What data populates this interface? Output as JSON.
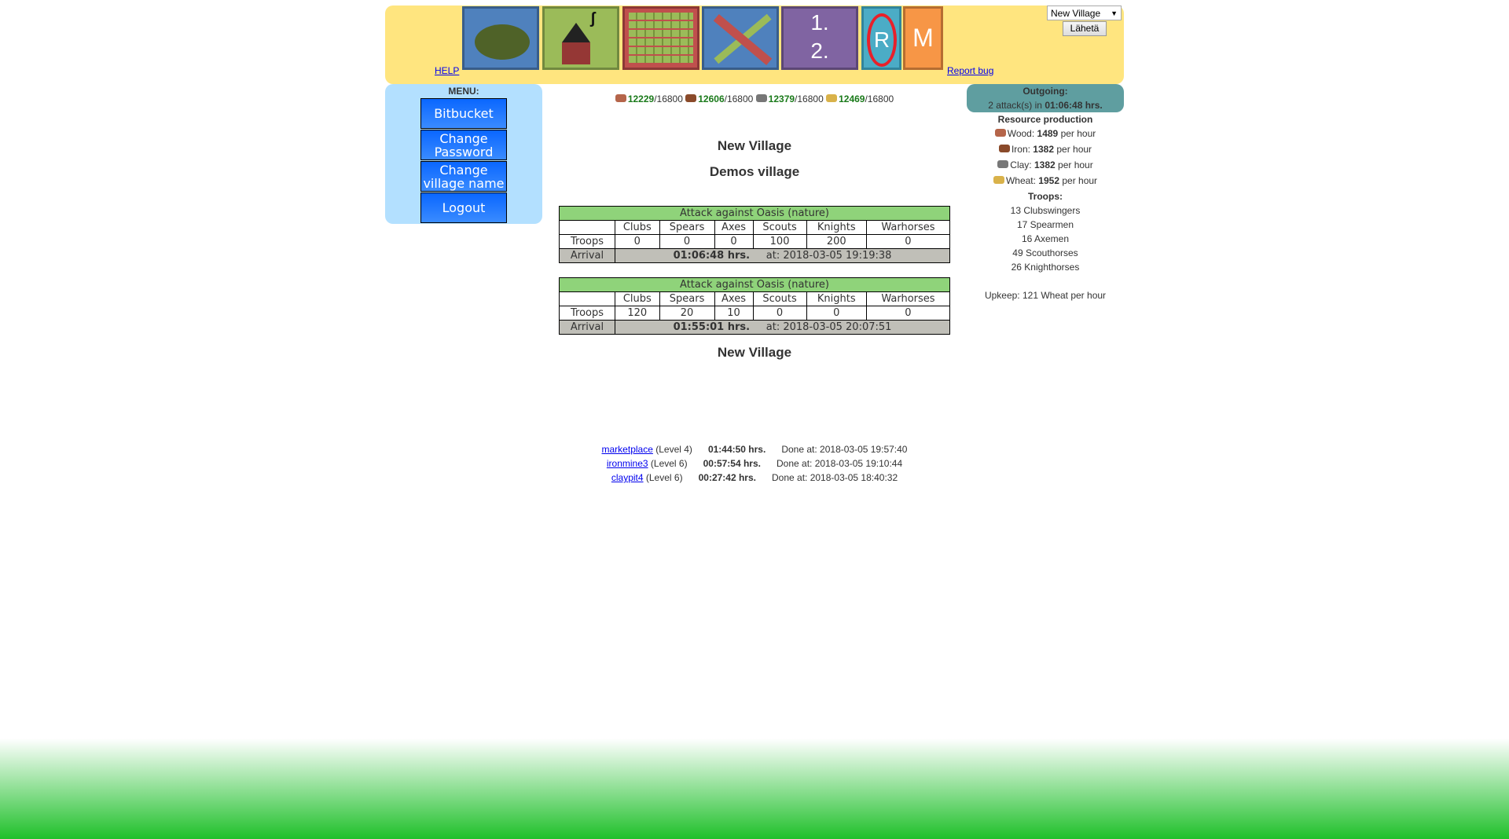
{
  "header": {
    "help": "HELP",
    "report_bug": "Report bug",
    "village_select": "New Village",
    "send": "Lähetä",
    "icons": [
      "map-icon",
      "village-icon",
      "fields-icon",
      "battle-icon",
      "ranking-icon",
      "reports-icon",
      "messages-icon"
    ],
    "ranking_text": [
      "1.",
      "2."
    ],
    "reports_text": "R",
    "messages_text": "M"
  },
  "menu": {
    "title": "MENU:",
    "items": [
      "Bitbucket",
      "Change Password",
      "Change village name",
      "Logout"
    ]
  },
  "resources": [
    {
      "name": "wood",
      "amount": "12229",
      "cap": "/16800",
      "color": "#b5654a"
    },
    {
      "name": "iron",
      "amount": "12606",
      "cap": "/16800",
      "color": "#8a4a2a"
    },
    {
      "name": "clay",
      "amount": "12379",
      "cap": "/16800",
      "color": "#777"
    },
    {
      "name": "wheat",
      "amount": "12469",
      "cap": "/16800",
      "color": "#d9b24a"
    }
  ],
  "village": {
    "name": "New Village",
    "subtitle": "Demos village",
    "footer_name": "New Village"
  },
  "attacks": [
    {
      "title": "Attack against Oasis (nature)",
      "headers": [
        "Clubs",
        "Spears",
        "Axes",
        "Scouts",
        "Knights",
        "Warhorses"
      ],
      "troops_label": "Troops",
      "troops": [
        "0",
        "0",
        "0",
        "100",
        "200",
        "0"
      ],
      "arrival_label": "Arrival",
      "duration": "01:06:48 hrs.",
      "at": "at: 2018-03-05 19:19:38"
    },
    {
      "title": "Attack against Oasis (nature)",
      "headers": [
        "Clubs",
        "Spears",
        "Axes",
        "Scouts",
        "Knights",
        "Warhorses"
      ],
      "troops_label": "Troops",
      "troops": [
        "120",
        "20",
        "10",
        "0",
        "0",
        "0"
      ],
      "arrival_label": "Arrival",
      "duration": "01:55:01 hrs.",
      "at": "at: 2018-03-05 20:07:51"
    }
  ],
  "construction": [
    {
      "building": "marketplace",
      "level": "(Level 4)",
      "time": "01:44:50 hrs.",
      "done": "Done at: 2018-03-05 19:57:40"
    },
    {
      "building": "ironmine3",
      "level": "(Level 6)",
      "time": "00:57:54 hrs.",
      "done": "Done at: 2018-03-05 19:10:44"
    },
    {
      "building": "claypit4",
      "level": "(Level 6)",
      "time": "00:27:42 hrs.",
      "done": "Done at: 2018-03-05 18:40:32"
    }
  ],
  "sidebar": {
    "outgoing_title": "Outgoing:",
    "outgoing_prefix": "2 attack(s) in",
    "outgoing_time": "01:06:48 hrs.",
    "production_title": "Resource production",
    "production": [
      {
        "label": "Wood:",
        "value": "1489",
        "unit": "per hour"
      },
      {
        "label": "Iron:",
        "value": "1382",
        "unit": "per hour"
      },
      {
        "label": "Clay:",
        "value": "1382",
        "unit": "per hour"
      },
      {
        "label": "Wheat:",
        "value": "1952",
        "unit": "per hour"
      }
    ],
    "troops_title": "Troops:",
    "troops": [
      "13 Clubswingers",
      "17 Spearmen",
      "16 Axemen",
      "49 Scouthorses",
      "26 Knighthorses"
    ],
    "upkeep": "Upkeep: 121 Wheat per hour"
  }
}
